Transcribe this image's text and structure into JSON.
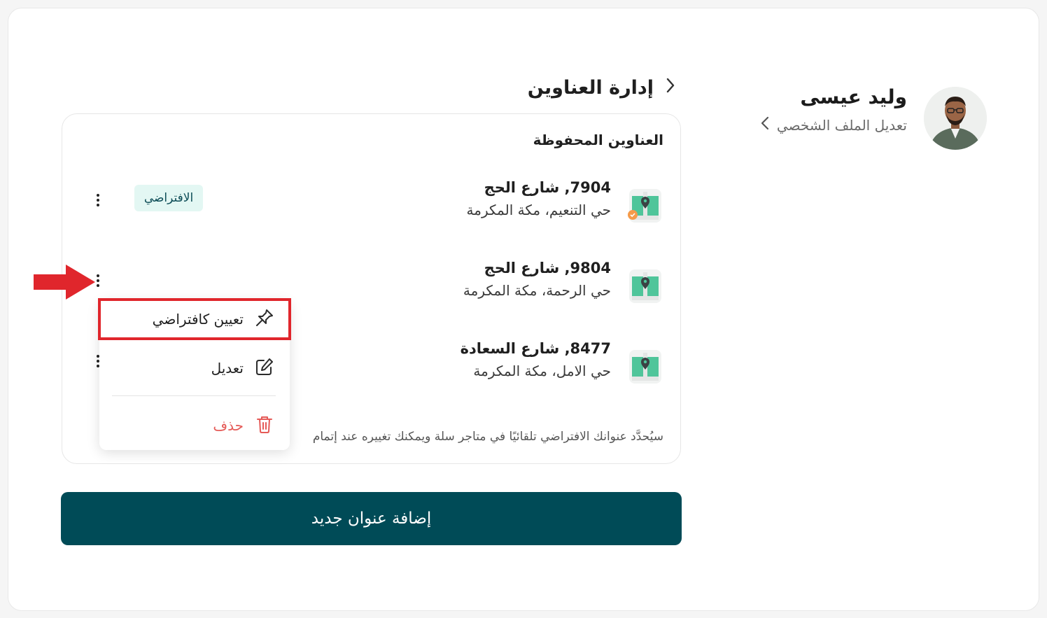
{
  "profile": {
    "name": "وليد عيسى",
    "edit_link": "تعديل الملف الشخصي"
  },
  "page": {
    "title": "إدارة العناوين"
  },
  "saved": {
    "title": "العناوين المحفوظة",
    "default_badge": "الافتراضي",
    "addresses": [
      {
        "line1": "7904, شارع الحج",
        "line2": "حي التنعيم، مكة المكرمة",
        "is_default": true
      },
      {
        "line1": "9804, شارع الحج",
        "line2": "حي الرحمة، مكة المكرمة",
        "is_default": false
      },
      {
        "line1": "8477, شارع السعادة",
        "line2": "حي الامل، مكة المكرمة",
        "is_default": false
      }
    ],
    "note": "سيُحدَّد عنوانك الافتراضي تلقائيًا في متاجر سلة ويمكنك تغييره عند إتمام"
  },
  "menu": {
    "set_default": "تعيين كافتراضي",
    "edit": "تعديل",
    "delete": "حذف"
  },
  "actions": {
    "add_address": "إضافة عنوان جديد"
  },
  "colors": {
    "primary": "#004b57",
    "badge_bg": "#e3f7f3",
    "delete": "#e55a57",
    "annotation": "#e0262c"
  }
}
